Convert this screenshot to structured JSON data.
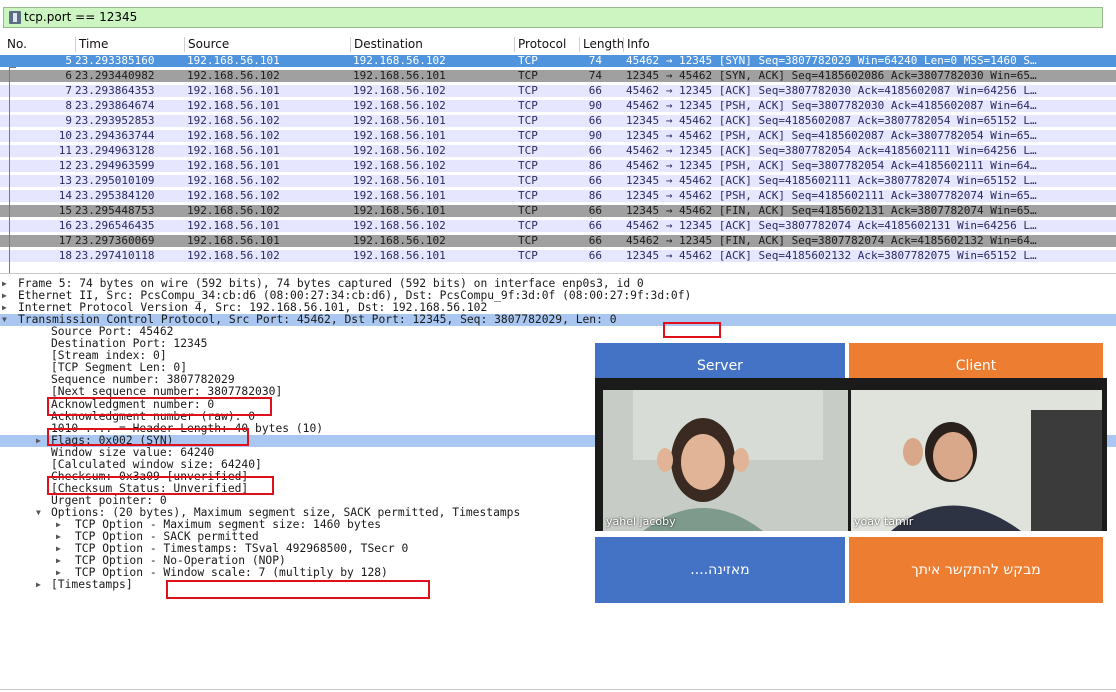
{
  "filter": {
    "value": "tcp.port == 12345"
  },
  "columns": [
    "No.",
    "Time",
    "Source",
    "Destination",
    "Protocol",
    "Length",
    "Info"
  ],
  "packets": [
    {
      "no": "5",
      "time": "23.293385160",
      "src": "192.168.56.101",
      "dst": "192.168.56.102",
      "proto": "TCP",
      "len": "74",
      "info": "45462 → 12345 [SYN] Seq=3807782029 Win=64240 Len=0 MSS=1460 S…",
      "style": "sel"
    },
    {
      "no": "6",
      "time": "23.293440982",
      "src": "192.168.56.102",
      "dst": "192.168.56.101",
      "proto": "TCP",
      "len": "74",
      "info": "12345 → 45462 [SYN, ACK] Seq=4185602086 Ack=3807782030 Win=65…",
      "style": "gray"
    },
    {
      "no": "7",
      "time": "23.293864353",
      "src": "192.168.56.101",
      "dst": "192.168.56.102",
      "proto": "TCP",
      "len": "66",
      "info": "45462 → 12345 [ACK] Seq=3807782030 Ack=4185602087 Win=64256 L…",
      "style": "light"
    },
    {
      "no": "8",
      "time": "23.293864674",
      "src": "192.168.56.101",
      "dst": "192.168.56.102",
      "proto": "TCP",
      "len": "90",
      "info": "45462 → 12345 [PSH, ACK] Seq=3807782030 Ack=4185602087 Win=64…",
      "style": "light"
    },
    {
      "no": "9",
      "time": "23.293952853",
      "src": "192.168.56.102",
      "dst": "192.168.56.101",
      "proto": "TCP",
      "len": "66",
      "info": "12345 → 45462 [ACK] Seq=4185602087 Ack=3807782054 Win=65152 L…",
      "style": "light"
    },
    {
      "no": "10",
      "time": "23.294363744",
      "src": "192.168.56.102",
      "dst": "192.168.56.101",
      "proto": "TCP",
      "len": "90",
      "info": "12345 → 45462 [PSH, ACK] Seq=4185602087 Ack=3807782054 Win=65…",
      "style": "light"
    },
    {
      "no": "11",
      "time": "23.294963128",
      "src": "192.168.56.101",
      "dst": "192.168.56.102",
      "proto": "TCP",
      "len": "66",
      "info": "45462 → 12345 [ACK] Seq=3807782054 Ack=4185602111 Win=64256 L…",
      "style": "light"
    },
    {
      "no": "12",
      "time": "23.294963599",
      "src": "192.168.56.101",
      "dst": "192.168.56.102",
      "proto": "TCP",
      "len": "86",
      "info": "45462 → 12345 [PSH, ACK] Seq=3807782054 Ack=4185602111 Win=64…",
      "style": "light"
    },
    {
      "no": "13",
      "time": "23.295010109",
      "src": "192.168.56.102",
      "dst": "192.168.56.101",
      "proto": "TCP",
      "len": "66",
      "info": "12345 → 45462 [ACK] Seq=4185602111 Ack=3807782074 Win=65152 L…",
      "style": "light"
    },
    {
      "no": "14",
      "time": "23.295384120",
      "src": "192.168.56.102",
      "dst": "192.168.56.101",
      "proto": "TCP",
      "len": "86",
      "info": "12345 → 45462 [PSH, ACK] Seq=4185602111 Ack=3807782074 Win=65…",
      "style": "light"
    },
    {
      "no": "15",
      "time": "23.295448753",
      "src": "192.168.56.102",
      "dst": "192.168.56.101",
      "proto": "TCP",
      "len": "66",
      "info": "12345 → 45462 [FIN, ACK] Seq=4185602131 Ack=3807782074 Win=65…",
      "style": "gray"
    },
    {
      "no": "16",
      "time": "23.296546435",
      "src": "192.168.56.101",
      "dst": "192.168.56.102",
      "proto": "TCP",
      "len": "66",
      "info": "45462 → 12345 [ACK] Seq=3807782074 Ack=4185602131 Win=64256 L…",
      "style": "light"
    },
    {
      "no": "17",
      "time": "23.297360069",
      "src": "192.168.56.101",
      "dst": "192.168.56.102",
      "proto": "TCP",
      "len": "66",
      "info": "45462 → 12345 [FIN, ACK] Seq=3807782074 Ack=4185602132 Win=64…",
      "style": "gray"
    },
    {
      "no": "18",
      "time": "23.297410118",
      "src": "192.168.56.102",
      "dst": "192.168.56.101",
      "proto": "TCP",
      "len": "66",
      "info": "12345 → 45462 [ACK] Seq=4185602132 Ack=3807782075 Win=65152 L…",
      "style": "light"
    }
  ],
  "details": [
    {
      "text": "Frame 5: 74 bytes on wire (592 bits), 74 bytes captured (592 bits) on interface enp0s3, id 0",
      "indent": 0,
      "arrow": "collapsed"
    },
    {
      "text": "Ethernet II, Src: PcsCompu_34:cb:d6 (08:00:27:34:cb:d6), Dst: PcsCompu_9f:3d:0f (08:00:27:9f:3d:0f)",
      "indent": 0,
      "arrow": "collapsed"
    },
    {
      "text": "Internet Protocol Version 4, Src: 192.168.56.101, Dst: 192.168.56.102",
      "indent": 0,
      "arrow": "collapsed"
    },
    {
      "text": "Transmission Control Protocol, Src Port: 45462, Dst Port: 12345, Seq: 3807782029, Len: 0",
      "indent": 0,
      "arrow": "expanded",
      "selected": true
    },
    {
      "text": "Source Port: 45462",
      "indent": 1
    },
    {
      "text": "Destination Port: 12345",
      "indent": 1
    },
    {
      "text": "[Stream index: 0]",
      "indent": 1
    },
    {
      "text": "[TCP Segment Len: 0]",
      "indent": 1
    },
    {
      "text": "Sequence number: 3807782029",
      "indent": 1
    },
    {
      "text": "[Next sequence number: 3807782030]",
      "indent": 1
    },
    {
      "text": "Acknowledgment number: 0",
      "indent": 1
    },
    {
      "text": "Acknowledgment number (raw): 0",
      "indent": 1
    },
    {
      "text": "1010 .... = Header Length: 40 bytes (10)",
      "indent": 1
    },
    {
      "text": "Flags: 0x002 (SYN)",
      "indent": 1,
      "arrow": "collapsed",
      "selected": true
    },
    {
      "text": "Window size value: 64240",
      "indent": 1
    },
    {
      "text": "[Calculated window size: 64240]",
      "indent": 1
    },
    {
      "text": "Checksum: 0x3a09 [unverified]",
      "indent": 1
    },
    {
      "text": "[Checksum Status: Unverified]",
      "indent": 1
    },
    {
      "text": "Urgent pointer: 0",
      "indent": 1
    },
    {
      "text": "Options: (20 bytes), Maximum segment size, SACK permitted, Timestamps",
      "indent": 1,
      "arrow": "expanded"
    },
    {
      "text": "TCP Option - Maximum segment size: 1460 bytes",
      "indent": 2,
      "arrow": "collapsed"
    },
    {
      "text": "TCP Option - SACK permitted",
      "indent": 2,
      "arrow": "collapsed"
    },
    {
      "text": "TCP Option - Timestamps: TSval 492968500, TSecr 0",
      "indent": 2,
      "arrow": "collapsed"
    },
    {
      "text": "TCP Option - No-Operation (NOP)",
      "indent": 2,
      "arrow": "collapsed"
    },
    {
      "text": "TCP Option - Window scale: 7 (multiply by 128)",
      "indent": 2,
      "arrow": "collapsed"
    },
    {
      "text": "[Timestamps]",
      "indent": 1,
      "arrow": "collapsed"
    }
  ],
  "overlay": {
    "server_label": "Server",
    "client_label": "Client",
    "server_caption": "מאזינה....",
    "client_caption": "מבקש להתקשר איתך",
    "server_person": "yahel jacoby",
    "client_person": "yoav tamir"
  },
  "colors": {
    "filter_bg": "#cdf5c2",
    "selected_row": "#4f94dc",
    "tcp_row": "#e7e6ff",
    "flag_row": "#a0a0a0",
    "highlight_box": "#e0101a",
    "server_blue": "#4473c5",
    "client_orange": "#ed7d31"
  }
}
